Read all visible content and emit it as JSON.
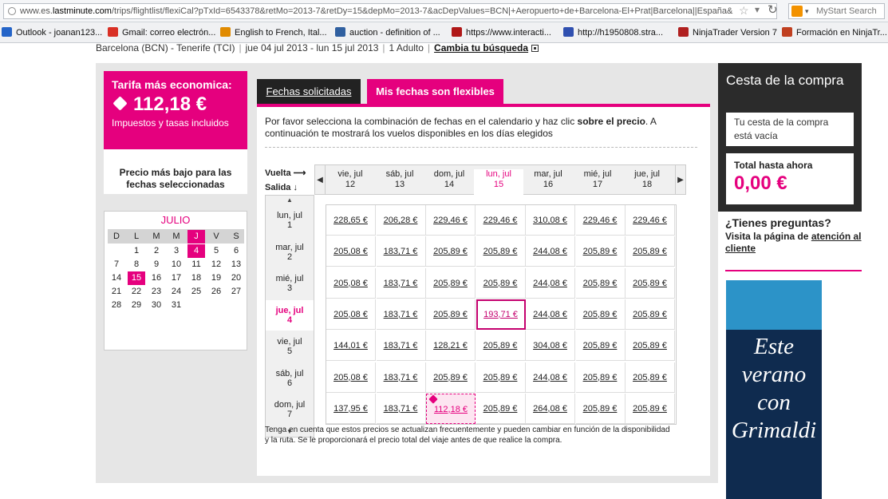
{
  "browser": {
    "url_prefix": "www.es.",
    "url_domain": "lastminute.com",
    "url_rest": "/trips/flightlist/flexiCal?pTxId=6543378&retMo=2013-7&retDy=15&depMo=2013-7&acDepValues=BCN|+Aeropuerto+de+Barcelona-El+Prat|Barcelona||España&",
    "search_placeholder": "MyStart Search"
  },
  "bookmarks": [
    {
      "label": "Outlook - joanan123...",
      "color": "#2464c8"
    },
    {
      "label": "Gmail: correo electrón...",
      "color": "#d93025"
    },
    {
      "label": "English to French, Ital...",
      "color": "#e08a00"
    },
    {
      "label": "auction - definition of ...",
      "color": "#3060a0"
    },
    {
      "label": "https://www.interacti...",
      "color": "#b01818"
    },
    {
      "label": "http://h1950808.stra...",
      "color": "#3050b0"
    },
    {
      "label": "NinjaTrader Version 7",
      "color": "#b02020"
    },
    {
      "label": "Formación en NinjaTr...",
      "color": "#c04020"
    }
  ],
  "summary": {
    "route": "Barcelona (BCN) - Tenerife (TCI)",
    "dates": "jue 04 jul 2013 - lun 15 jul 2013",
    "pax": "1 Adulto",
    "change_link": "Cambia tu búsqueda"
  },
  "fare": {
    "title": "Tarifa más economica:",
    "price": "112,18 €",
    "taxes": "Impuestos y tasas incluidos",
    "lowest_label": "Precio más bajo para las fechas seleccionadas"
  },
  "minical": {
    "month": "JULIO",
    "weekdays": [
      "D",
      "L",
      "M",
      "M",
      "J",
      "V",
      "S"
    ],
    "weeks": [
      [
        "",
        "1",
        "2",
        "3",
        "4",
        "5",
        "6"
      ],
      [
        "7",
        "8",
        "9",
        "10",
        "11",
        "12",
        "13"
      ],
      [
        "14",
        "15",
        "16",
        "17",
        "18",
        "19",
        "20"
      ],
      [
        "21",
        "22",
        "23",
        "24",
        "25",
        "26",
        "27"
      ],
      [
        "28",
        "29",
        "30",
        "31",
        "",
        "",
        ""
      ]
    ],
    "highlighted_days": [
      "4",
      "15"
    ],
    "highlighted_column": 4
  },
  "tabs": {
    "requested": "Fechas solicitadas",
    "flexible": "Mis fechas son flexibles"
  },
  "instructions_a": "Por favor selecciona la combinación de fechas en el calendario y haz clic ",
  "instructions_bold": "sobre el precio",
  "instructions_b": ". A continuación te mostrará los vuelos disponibles en los días elegidos",
  "grid": {
    "return_label": "Vuelta",
    "depart_label": "Salida",
    "columns": [
      {
        "day": "vie, jul",
        "num": "12"
      },
      {
        "day": "sáb, jul",
        "num": "13"
      },
      {
        "day": "dom, jul",
        "num": "14"
      },
      {
        "day": "lun, jul",
        "num": "15"
      },
      {
        "day": "mar, jul",
        "num": "16"
      },
      {
        "day": "mié, jul",
        "num": "17"
      },
      {
        "day": "jue, jul",
        "num": "18"
      }
    ],
    "rows": [
      {
        "day": "lun, jul",
        "num": "1"
      },
      {
        "day": "mar, jul",
        "num": "2"
      },
      {
        "day": "mié, jul",
        "num": "3"
      },
      {
        "day": "jue, jul",
        "num": "4"
      },
      {
        "day": "vie, jul",
        "num": "5"
      },
      {
        "day": "sáb, jul",
        "num": "6"
      },
      {
        "day": "dom, jul",
        "num": "7"
      }
    ],
    "selected_column": 3,
    "selected_row": 3,
    "lowest_cell": [
      6,
      2
    ],
    "prices": [
      [
        "228,65 €",
        "206,28 €",
        "229,46 €",
        "229,46 €",
        "310,08 €",
        "229,46 €",
        "229,46 €"
      ],
      [
        "205,08 €",
        "183,71 €",
        "205,89 €",
        "205,89 €",
        "244,08 €",
        "205,89 €",
        "205,89 €"
      ],
      [
        "205,08 €",
        "183,71 €",
        "205,89 €",
        "205,89 €",
        "244,08 €",
        "205,89 €",
        "205,89 €"
      ],
      [
        "205,08 €",
        "183,71 €",
        "205,89 €",
        "193,71 €",
        "244,08 €",
        "205,89 €",
        "205,89 €"
      ],
      [
        "144,01 €",
        "183,71 €",
        "128,21 €",
        "205,89 €",
        "304,08 €",
        "205,89 €",
        "205,89 €"
      ],
      [
        "205,08 €",
        "183,71 €",
        "205,89 €",
        "205,89 €",
        "244,08 €",
        "205,89 €",
        "205,89 €"
      ],
      [
        "137,95 €",
        "183,71 €",
        "112,18 €",
        "205,89 €",
        "264,08 €",
        "205,89 €",
        "205,89 €"
      ]
    ]
  },
  "note": "Tenga en cuenta que estos precios se actualizan frecuentemente y pueden cambiar en función de la disponibilidad y la ruta. Se le proporcionará el precio total del viaje antes de que realice la compra.",
  "cart": {
    "title": "Cesta de la compra",
    "empty": "Tu cesta de la compra está vacía",
    "total_label": "Total hasta ahora",
    "total_value": "0,00 €"
  },
  "help": {
    "question": "¿Tienes preguntas?",
    "visit": "Visita la página de ",
    "link": "atención al cliente"
  },
  "ad": {
    "line1": "Este",
    "line2": "verano",
    "line3": "con",
    "line4": "Grimaldi"
  },
  "colors": {
    "accent": "#e5007e",
    "dark": "#2b2b2b",
    "ad_bg": "#0f2b4f"
  }
}
